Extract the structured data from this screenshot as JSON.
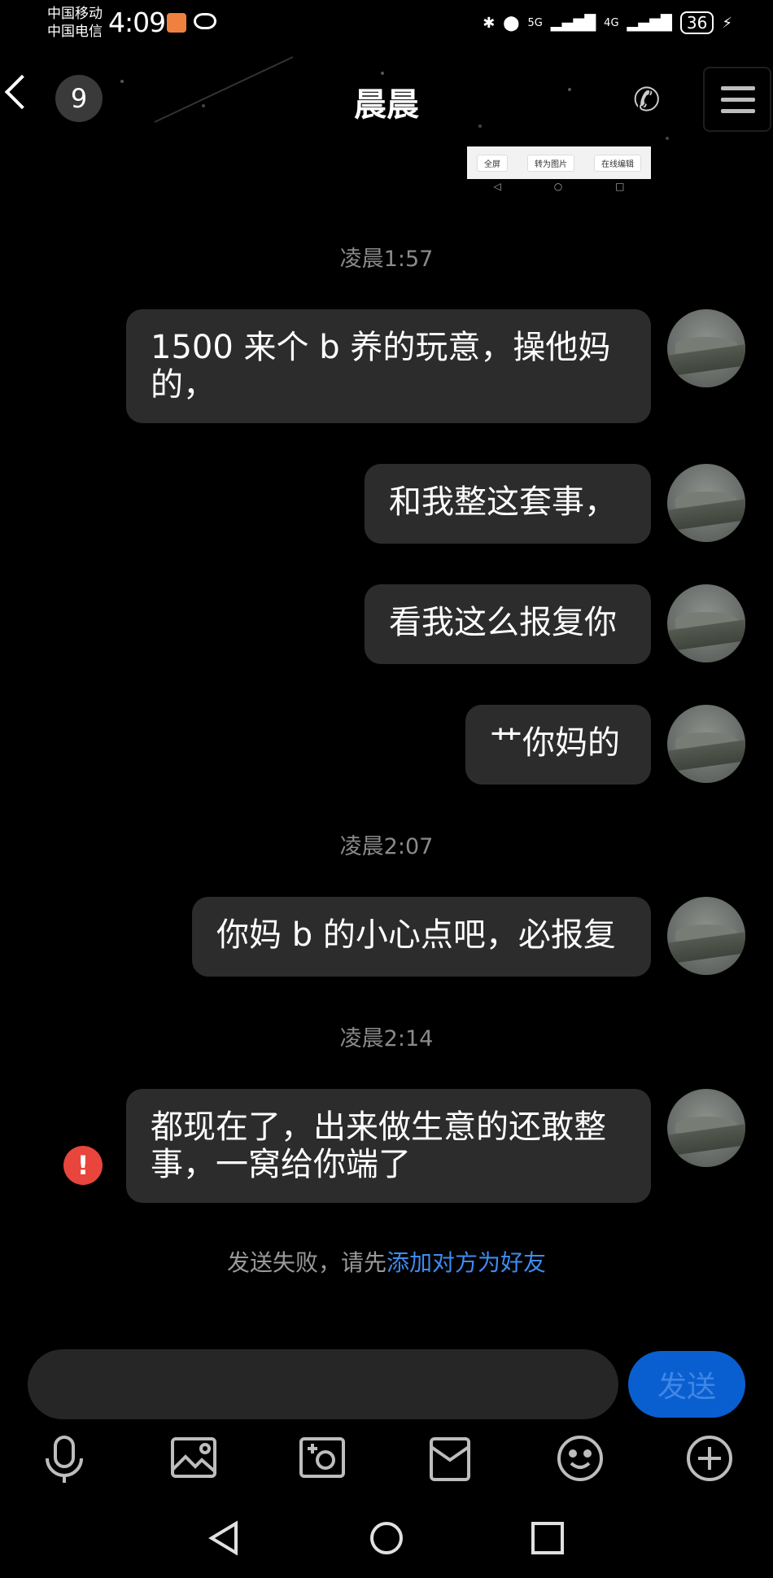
{
  "status_bar": {
    "carrier1": "中国移动",
    "carrier2": "中国电信",
    "time": "4:09",
    "net1": "5G",
    "net2": "4G",
    "battery": "36"
  },
  "header": {
    "back_icon": "chevron-left-icon",
    "unread_count": "9",
    "title": "晨晨",
    "phone_icon": "phone-icon",
    "menu_icon": "menu-icon"
  },
  "preview": {
    "btn_fullscreen": "全屏",
    "btn_to_image": "转为图片",
    "btn_edit": "在线编辑"
  },
  "messages": [
    {
      "time": "凌晨1:57"
    },
    {
      "text": "1500 来个 b 养的玩意，操他妈的，"
    },
    {
      "text": "和我整这套事，"
    },
    {
      "text": "看我这么报复你"
    },
    {
      "text": "艹你妈的"
    },
    {
      "time": "凌晨2:07"
    },
    {
      "text": "你妈 b 的小心点吧，必报复"
    },
    {
      "time": "凌晨2:14"
    },
    {
      "text": "都现在了，出来做生意的还敢整事，一窝给你端了",
      "failed": true
    }
  ],
  "failed_notice": {
    "prefix": "发送失败，请先",
    "link": "添加对方为好友"
  },
  "composer": {
    "input_value": "",
    "send_label": "发送",
    "send_color": "#0a5fd0"
  },
  "toolbar": [
    "mic-icon",
    "image-icon",
    "camera-icon",
    "folder-icon",
    "emoji-icon",
    "plus-icon"
  ],
  "system_nav": [
    "back-triangle-icon",
    "home-circle-icon",
    "recents-square-icon"
  ],
  "colors": {
    "bubble": "#2c2c2c",
    "error": "#e8453c",
    "link": "#3d8cf0"
  }
}
